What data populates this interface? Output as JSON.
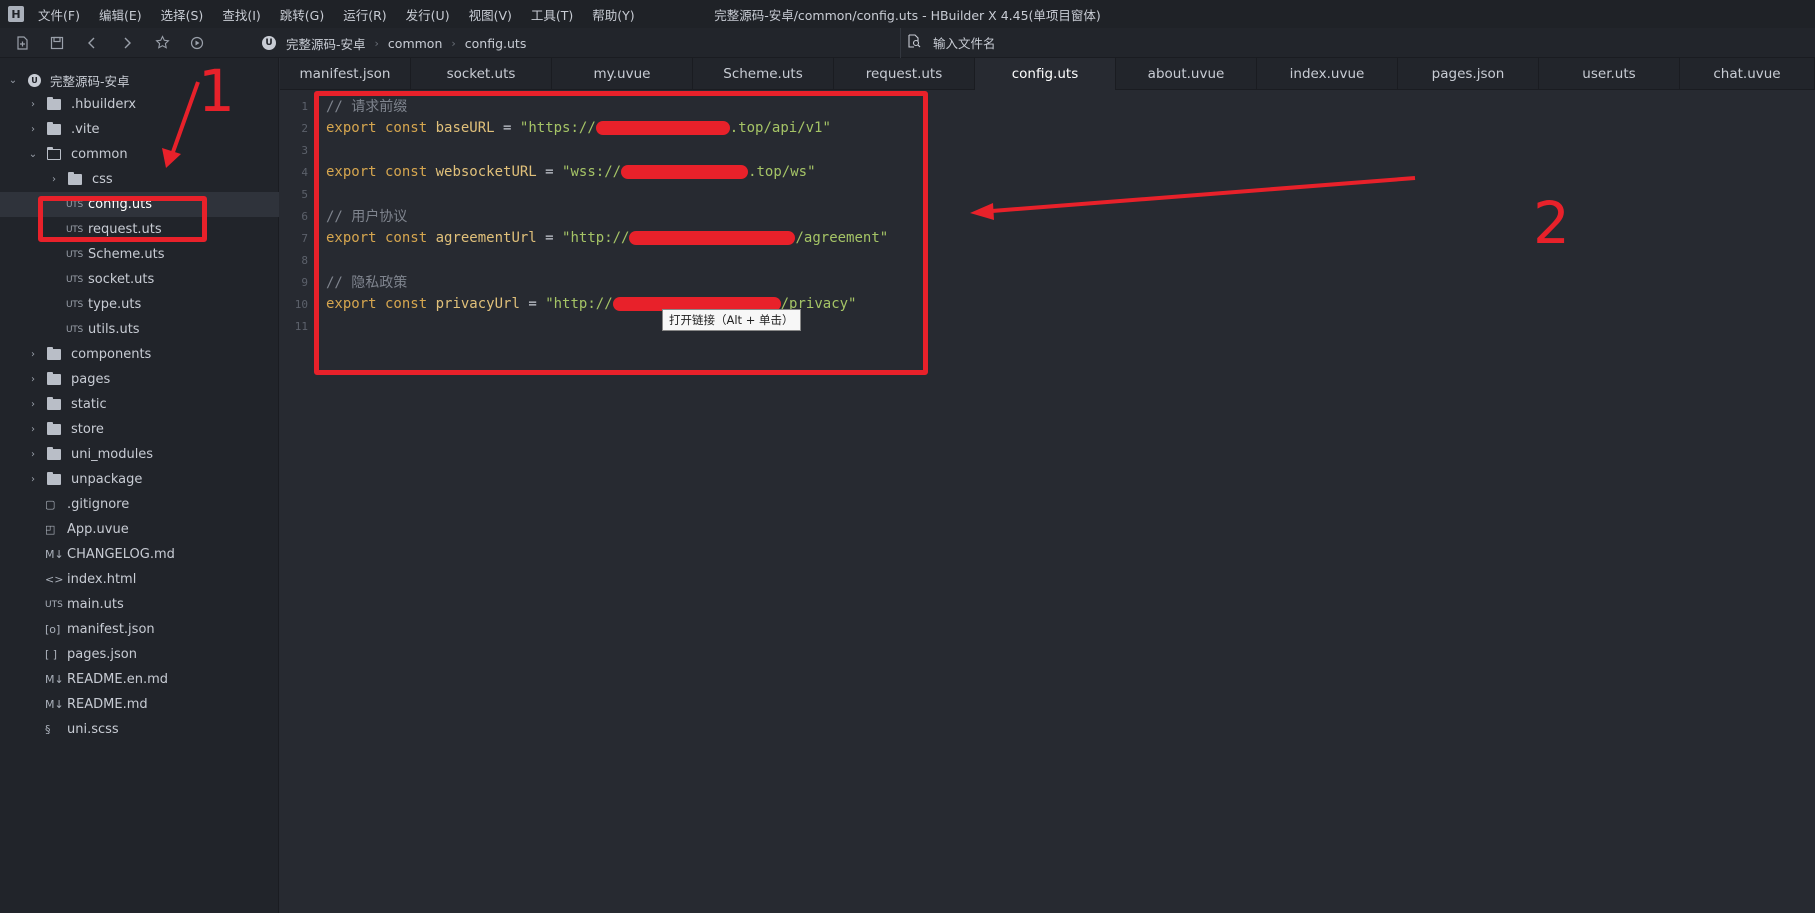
{
  "menubar": {
    "logo": "H",
    "items": [
      "文件(F)",
      "编辑(E)",
      "选择(S)",
      "查找(I)",
      "跳转(G)",
      "运行(R)",
      "发行(U)",
      "视图(V)",
      "工具(T)",
      "帮助(Y)"
    ],
    "window_title": "完整源码-安卓/common/config.uts - HBuilder X 4.45(单项目窗体)"
  },
  "toolbar": {
    "icons": [
      "new-file-icon",
      "save-icon",
      "back-arrow-icon",
      "forward-arrow-icon",
      "star-icon",
      "run-icon"
    ],
    "breadcrumb": [
      "完整源码-安卓",
      "common",
      "config.uts"
    ],
    "file_search_placeholder": "输入文件名"
  },
  "sidebar": {
    "project": "完整源码-安卓",
    "items": [
      {
        "label": ".hbuilderx",
        "type": "folder",
        "depth": 1,
        "expanded": false
      },
      {
        "label": ".vite",
        "type": "folder",
        "depth": 1,
        "expanded": false
      },
      {
        "label": "common",
        "type": "folder",
        "depth": 1,
        "expanded": true
      },
      {
        "label": "css",
        "type": "folder",
        "depth": 2,
        "expanded": false
      },
      {
        "label": "config.uts",
        "type": "file",
        "tag": "UTS",
        "depth": 2,
        "selected": true
      },
      {
        "label": "request.uts",
        "type": "file",
        "tag": "UTS",
        "depth": 2
      },
      {
        "label": "Scheme.uts",
        "type": "file",
        "tag": "UTS",
        "depth": 2
      },
      {
        "label": "socket.uts",
        "type": "file",
        "tag": "UTS",
        "depth": 2
      },
      {
        "label": "type.uts",
        "type": "file",
        "tag": "UTS",
        "depth": 2
      },
      {
        "label": "utils.uts",
        "type": "file",
        "tag": "UTS",
        "depth": 2
      },
      {
        "label": "components",
        "type": "folder",
        "depth": 1,
        "expanded": false
      },
      {
        "label": "pages",
        "type": "folder",
        "depth": 1,
        "expanded": false
      },
      {
        "label": "static",
        "type": "folder",
        "depth": 1,
        "expanded": false
      },
      {
        "label": "store",
        "type": "folder",
        "depth": 1,
        "expanded": false
      },
      {
        "label": "uni_modules",
        "type": "folder",
        "depth": 1,
        "expanded": false
      },
      {
        "label": "unpackage",
        "type": "folder",
        "depth": 1,
        "expanded": false
      },
      {
        "label": ".gitignore",
        "type": "file",
        "glyph": "▢",
        "depth": 1
      },
      {
        "label": "App.uvue",
        "type": "file",
        "glyph": "◰",
        "depth": 1
      },
      {
        "label": "CHANGELOG.md",
        "type": "file",
        "glyph": "M↓",
        "depth": 1
      },
      {
        "label": "index.html",
        "type": "file",
        "glyph": "<>",
        "depth": 1
      },
      {
        "label": "main.uts",
        "type": "file",
        "glyph": "UTS",
        "depth": 1
      },
      {
        "label": "manifest.json",
        "type": "file",
        "glyph": "[o]",
        "depth": 1
      },
      {
        "label": "pages.json",
        "type": "file",
        "glyph": "[ ]",
        "depth": 1
      },
      {
        "label": "README.en.md",
        "type": "file",
        "glyph": "M↓",
        "depth": 1
      },
      {
        "label": "README.md",
        "type": "file",
        "glyph": "M↓",
        "depth": 1
      },
      {
        "label": "uni.scss",
        "type": "file",
        "glyph": "§",
        "depth": 1
      }
    ]
  },
  "tabs": [
    {
      "label": "manifest.json",
      "active": false
    },
    {
      "label": "socket.uts",
      "active": false
    },
    {
      "label": "my.uvue",
      "active": false
    },
    {
      "label": "Scheme.uts",
      "active": false
    },
    {
      "label": "request.uts",
      "active": false
    },
    {
      "label": "config.uts",
      "active": true
    },
    {
      "label": "about.uvue",
      "active": false
    },
    {
      "label": "index.uvue",
      "active": false
    },
    {
      "label": "pages.json",
      "active": false
    },
    {
      "label": "user.uts",
      "active": false
    },
    {
      "label": "chat.uvue",
      "active": false
    }
  ],
  "editor": {
    "lines": [
      {
        "n": "1",
        "comment": "// 请求前缀"
      },
      {
        "n": "2",
        "kw": "export const",
        "name": "baseURL",
        "op": " = ",
        "str_before": "\"https://",
        "str_after": ".top/api/v1\"",
        "redacted": true
      },
      {
        "n": "3"
      },
      {
        "n": "4",
        "kw": "export const",
        "name": "websocketURL",
        "op": " = ",
        "str_before": "\"wss://",
        "str_after": ".top/ws\"",
        "redacted": true
      },
      {
        "n": "5"
      },
      {
        "n": "6",
        "comment": "// 用户协议"
      },
      {
        "n": "7",
        "kw": "export const",
        "name": "agreementUrl",
        "op": " = ",
        "str_before": "\"http://",
        "str_after": "/agreement\"",
        "redacted": true
      },
      {
        "n": "8"
      },
      {
        "n": "9",
        "comment": "// 隐私政策"
      },
      {
        "n": "10",
        "kw": "export const",
        "name": "privacyUrl",
        "op": " = ",
        "str_before": "\"http://",
        "str_after": "/privacy\"",
        "redacted": true
      },
      {
        "n": "11"
      }
    ],
    "tooltip": "打开链接（Alt + 单击）"
  },
  "annotations": {
    "label_1": "1",
    "label_2": "2",
    "color": "#e8212a"
  }
}
